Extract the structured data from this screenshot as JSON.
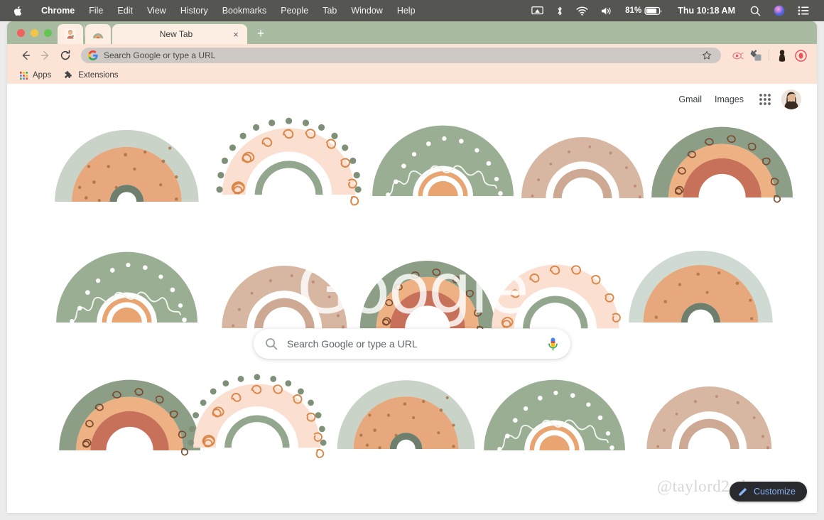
{
  "menubar": {
    "apple_icon": "apple-logo",
    "items": [
      {
        "label": "Chrome",
        "bold": true
      },
      {
        "label": "File",
        "bold": false
      },
      {
        "label": "Edit",
        "bold": false
      },
      {
        "label": "View",
        "bold": false
      },
      {
        "label": "History",
        "bold": false
      },
      {
        "label": "Bookmarks",
        "bold": false
      },
      {
        "label": "People",
        "bold": false
      },
      {
        "label": "Tab",
        "bold": false
      },
      {
        "label": "Window",
        "bold": false
      },
      {
        "label": "Help",
        "bold": false
      }
    ],
    "status": {
      "screen_mirroring_icon": "screen-mirroring-icon",
      "bluetooth_icon": "bluetooth-icon",
      "wifi_icon": "wifi-icon",
      "volume_icon": "volume-icon",
      "battery_percent": "81%",
      "battery_icon": "battery-icon",
      "clock": "Thu 10:18 AM",
      "search_icon": "spotlight-search-icon",
      "siri_icon": "siri-icon",
      "control_center_icon": "control-center-icon"
    }
  },
  "browser": {
    "tabstrip": {
      "pinned_tabs": [
        {
          "name": "pinned-tab-1",
          "favicon": "girl-illustration-favicon"
        },
        {
          "name": "pinned-tab-2",
          "favicon": "rainbow-favicon"
        }
      ],
      "active_tab": {
        "title": "New Tab",
        "close_label": "×"
      },
      "new_tab_label": "+"
    },
    "toolbar": {
      "back_icon": "back-arrow-icon",
      "forward_icon": "forward-arrow-icon",
      "reload_icon": "reload-icon",
      "omnibox": {
        "favicon": "google-g-icon",
        "placeholder": "Search Google or type a URL",
        "value": "",
        "bookmark_star_icon": "bookmark-star-icon"
      },
      "icons": [
        {
          "name": "extension-pink-icon"
        },
        {
          "name": "extensions-puzzle-icon"
        }
      ],
      "profile_icon": "profile-avatar-icon",
      "menu_icon": "chrome-menu-icon"
    },
    "bookmarks_bar": {
      "items": [
        {
          "label": "Apps",
          "icon": "apps-grid-icon"
        },
        {
          "label": "Extensions",
          "icon": "puzzle-piece-icon"
        }
      ]
    }
  },
  "newtab": {
    "header": {
      "gmail_label": "Gmail",
      "images_label": "Images",
      "apps_icon": "google-apps-grid-icon",
      "avatar": "user-profile-photo"
    },
    "logo_text": "Google",
    "search": {
      "placeholder": "Search Google or type a URL",
      "value": "",
      "search_icon": "search-magnifier-icon",
      "mic_icon": "microphone-icon"
    },
    "watermark": "@taylord2edu",
    "customize": {
      "label": "Customize",
      "icon": "pencil-edit-icon"
    },
    "theme": {
      "name": "boho-rainbows-wallpaper",
      "background": "#ffffff",
      "sage": "#9aae93",
      "sage_light": "#c8d4c6",
      "terracotta": "#c8715a",
      "peach": "#e8a471",
      "blush": "#fae2d4",
      "blush_light": "#fdeee6",
      "tan": "#d8b7a2",
      "accent_blue": "#8ab4f8",
      "tabstrip": "#a8bba0",
      "toolbar": "#fbe3d5"
    }
  }
}
